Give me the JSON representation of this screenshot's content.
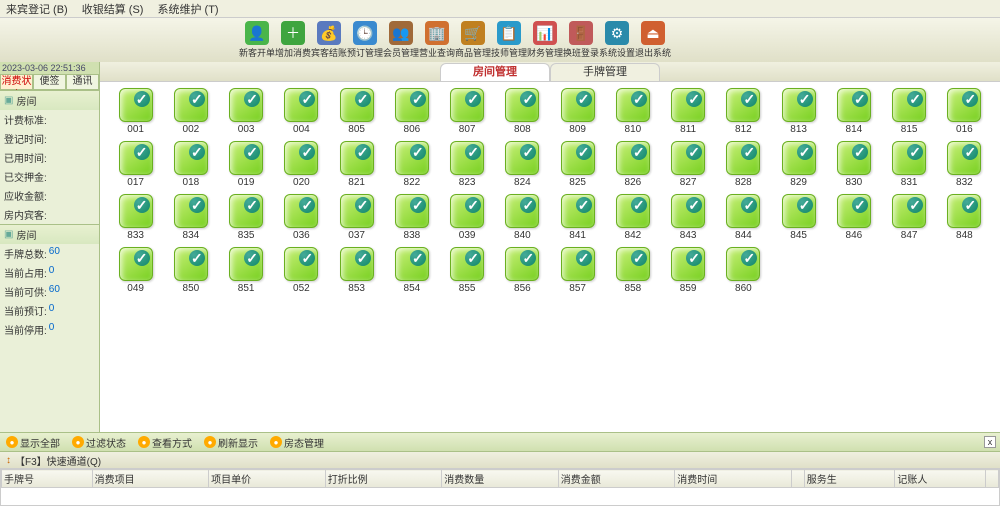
{
  "menu": [
    "来宾登记 (B)",
    "收银结算 (S)",
    "系统维护 (T)"
  ],
  "toolbar": [
    {
      "label": "新客开单",
      "color": "#4ab54a",
      "glyph": "👤"
    },
    {
      "label": "增加消费",
      "color": "#3fa53f",
      "glyph": "＋"
    },
    {
      "label": "宾客结账",
      "color": "#5a7abf",
      "glyph": "💰"
    },
    {
      "label": "预订管理",
      "color": "#3a8acf",
      "glyph": "🕒"
    },
    {
      "label": "会员管理",
      "color": "#a06a3a",
      "glyph": "👥"
    },
    {
      "label": "营业查询",
      "color": "#d07030",
      "glyph": "🏢"
    },
    {
      "label": "商品管理",
      "color": "#c08020",
      "glyph": "🛒"
    },
    {
      "label": "技师管理",
      "color": "#2a9aca",
      "glyph": "📋"
    },
    {
      "label": "财务管理",
      "color": "#d05050",
      "glyph": "📊"
    },
    {
      "label": "换班登录",
      "color": "#c05a5a",
      "glyph": "🚪"
    },
    {
      "label": "系统设置",
      "color": "#2a8aaa",
      "glyph": "⚙"
    },
    {
      "label": "退出系统",
      "color": "#d06030",
      "glyph": "⏏"
    }
  ],
  "timestamp": "2023-03-06 22:51:36",
  "sideTabs": [
    "消费状态",
    "便签",
    "通讯"
  ],
  "section1": {
    "title": "房间",
    "fields": [
      {
        "lbl": "计费标准:",
        "val": ""
      },
      {
        "lbl": "登记时间:",
        "val": ""
      },
      {
        "lbl": "已用时间:",
        "val": ""
      },
      {
        "lbl": "已交押金:",
        "val": ""
      },
      {
        "lbl": "应收金额:",
        "val": ""
      },
      {
        "lbl": "房内宾客:",
        "val": ""
      }
    ]
  },
  "section2": {
    "title": "房间",
    "fields": [
      {
        "lbl": "手牌总数:",
        "val": "60"
      },
      {
        "lbl": "当前占用:",
        "val": "0"
      },
      {
        "lbl": "当前可供:",
        "val": "60"
      },
      {
        "lbl": "当前预订:",
        "val": "0"
      },
      {
        "lbl": "当前停用:",
        "val": "0"
      }
    ]
  },
  "mainTabs": [
    "房间管理",
    "手牌管理"
  ],
  "rooms": [
    "001",
    "002",
    "003",
    "004",
    "805",
    "806",
    "807",
    "808",
    "809",
    "810",
    "811",
    "812",
    "813",
    "814",
    "815",
    "016",
    "017",
    "018",
    "019",
    "020",
    "821",
    "822",
    "823",
    "824",
    "825",
    "826",
    "827",
    "828",
    "829",
    "830",
    "831",
    "832",
    "833",
    "834",
    "835",
    "036",
    "037",
    "838",
    "039",
    "840",
    "841",
    "842",
    "843",
    "844",
    "845",
    "846",
    "847",
    "848",
    "049",
    "850",
    "851",
    "052",
    "853",
    "854",
    "855",
    "856",
    "857",
    "858",
    "859",
    "860"
  ],
  "footerBtns": [
    "显示全部",
    "过滤状态",
    "查看方式",
    "刷新显示",
    "房态管理"
  ],
  "quickHeader": "【F3】快速通道(Q)",
  "tableHeaders": [
    "手牌号",
    "消费项目",
    "项目单价",
    "打折比例",
    "消费数量",
    "消费金额",
    "消费时间",
    "",
    "服务生",
    "记账人",
    ""
  ]
}
